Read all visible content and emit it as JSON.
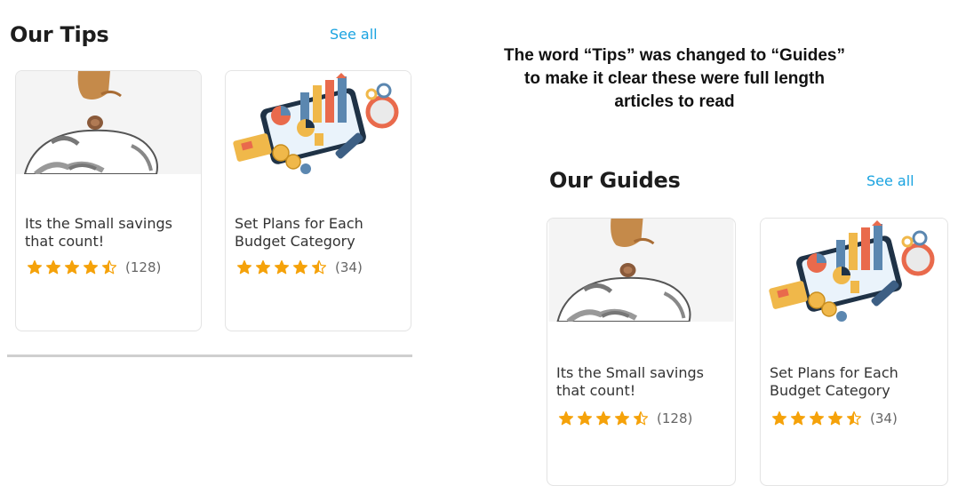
{
  "left_panel": {
    "section_title": "Our Tips",
    "see_all": "See all",
    "cards": [
      {
        "title": "Its the Small savings that count!",
        "rating": 4.5,
        "count": "(128)",
        "image": "piggy-bank-coin"
      },
      {
        "title": "Set Plans for Each Budget Category",
        "rating": 4.5,
        "count": "(34)",
        "image": "budget-phone-illustration"
      }
    ]
  },
  "annotation": {
    "text": "The word “Tips” was changed to “Guides” to make it clear these were full length articles to read"
  },
  "right_panel": {
    "section_title": "Our Guides",
    "see_all": "See all",
    "cards": [
      {
        "title": "Its the Small savings that count!",
        "rating": 4.5,
        "count": "(128)",
        "image": "piggy-bank-coin"
      },
      {
        "title": "Set Plans for Each Budget Category",
        "rating": 4.5,
        "count": "(34)",
        "image": "budget-phone-illustration"
      }
    ]
  },
  "colors": {
    "accent_link": "#1aa3e0",
    "star": "#f5a20a",
    "card_border": "#e4e4e4",
    "divider": "#cfcfcf"
  }
}
